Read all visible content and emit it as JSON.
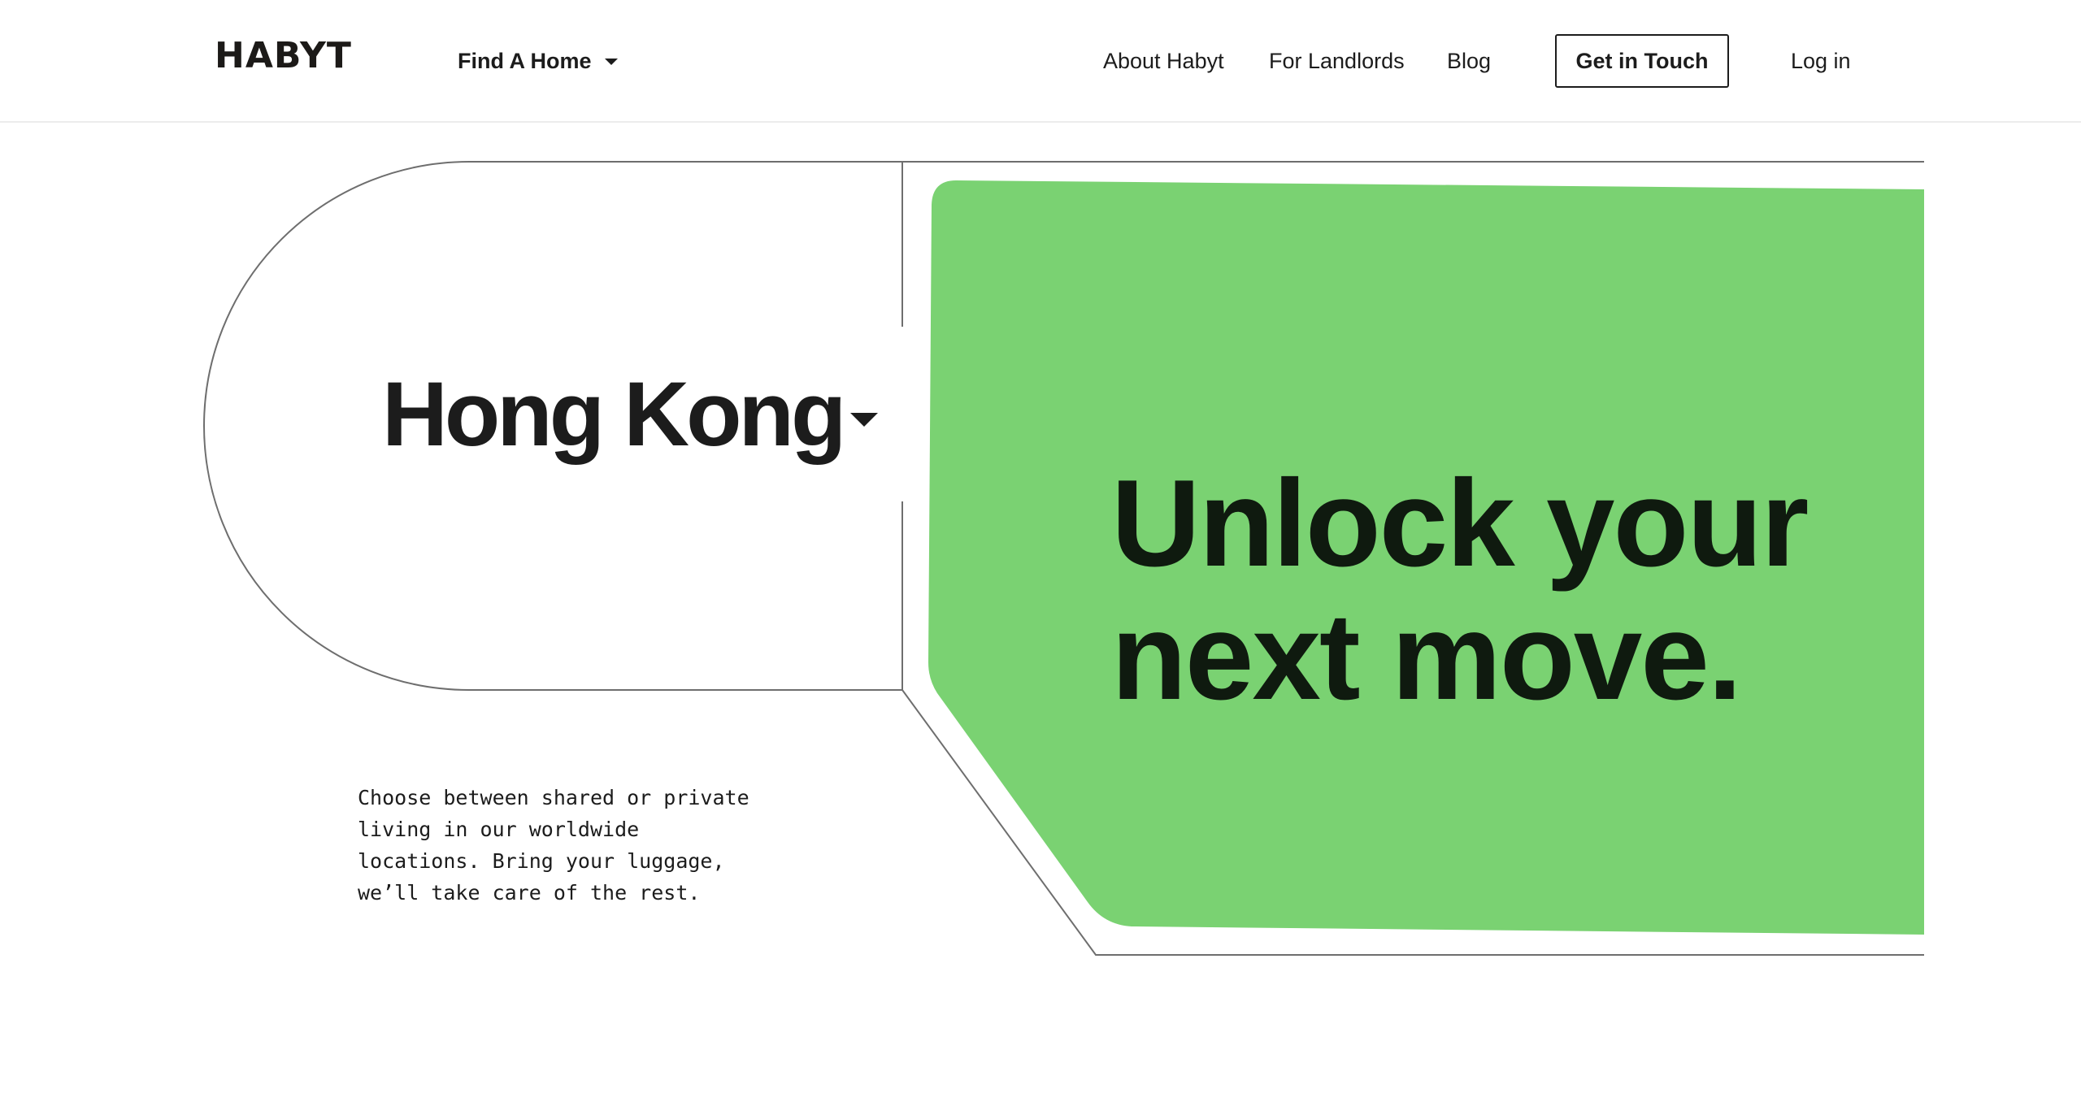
{
  "header": {
    "logo_text": "HABYT",
    "find_home_label": "Find A Home",
    "nav": {
      "about": "About Habyt",
      "landlords": "For Landlords",
      "blog": "Blog",
      "get_in_touch": "Get in Touch",
      "login": "Log in"
    }
  },
  "hero": {
    "city": "Hong Kong",
    "headline_lines": [
      "Unlock your",
      "next move."
    ],
    "tagline_lines": [
      "Choose between shared or private",
      "living in our worldwide",
      "locations. Bring your luggage,",
      "we’ll take care of the rest."
    ]
  },
  "colors": {
    "accent_green": "#7AD272",
    "text": "#1C1C1C",
    "outline": "#6E6E6E"
  },
  "icons": {
    "find_home_caret": "chevron-down-icon",
    "city_caret": "chevron-down-icon"
  }
}
